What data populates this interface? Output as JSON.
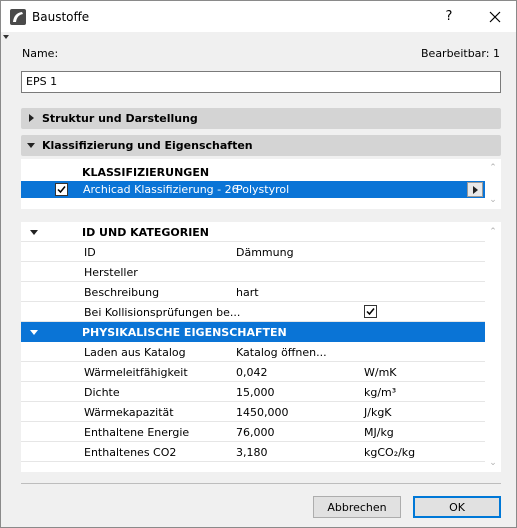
{
  "window": {
    "title": "Baustoffe",
    "help_label": "?"
  },
  "form": {
    "name_label": "Name:",
    "editable_label": "Bearbeitbar: 1",
    "name_value": "EPS 1"
  },
  "sections": {
    "struktur_label": "Struktur und Darstellung",
    "klassifizierung_label": "Klassifizierung und Eigenschaften"
  },
  "classifications": {
    "header": "KLASSIFIZIERUNGEN",
    "items": [
      {
        "name": "Archicad Klassifizierung - 26",
        "value": "Polystyrol",
        "checked": true
      }
    ]
  },
  "properties": {
    "groups": [
      {
        "title": "ID UND KATEGORIEN",
        "rows": [
          {
            "key": "ID",
            "value": "Dämmung",
            "unit": ""
          },
          {
            "key": "Hersteller",
            "value": "",
            "unit": ""
          },
          {
            "key": "Beschreibung",
            "value": "hart",
            "unit": ""
          },
          {
            "key": "Bei Kollisionsprüfungen be...",
            "value": "",
            "unit": "",
            "checked": true
          }
        ]
      },
      {
        "title": "PHYSIKALISCHE EIGENSCHAFTEN",
        "rows": [
          {
            "key": "Laden aus Katalog",
            "value": "Katalog öffnen...",
            "unit": ""
          },
          {
            "key": "Wärmeleitfähigkeit",
            "value": "0,042",
            "unit": "W/mK"
          },
          {
            "key": "Dichte",
            "value": "15,000",
            "unit": "kg/m³"
          },
          {
            "key": "Wärmekapazität",
            "value": "1450,000",
            "unit": "J/kgK"
          },
          {
            "key": "Enthaltene Energie",
            "value": "76,000",
            "unit": "MJ/kg"
          },
          {
            "key": "Enthaltenes CO2",
            "value": "3,180",
            "unit": "kgCO₂/kg"
          }
        ]
      }
    ]
  },
  "buttons": {
    "cancel": "Abbrechen",
    "ok": "OK"
  },
  "colors": {
    "selection": "#0a74d6",
    "section_header": "#d4d4d4",
    "dialog_bg": "#f0f0f0"
  },
  "icons": {
    "app": "archicad-icon",
    "close": "close-icon",
    "collapse": "triangle-down-icon",
    "expand": "triangle-right-icon"
  }
}
